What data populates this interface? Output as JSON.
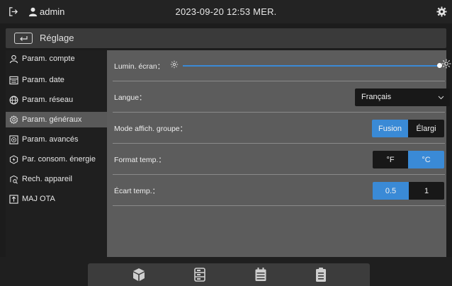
{
  "topbar": {
    "username": "admin",
    "datetime": "2023-09-20 12:53 MER.",
    "icons": [
      "logout-icon",
      "user-icon",
      "settings-gear-icon"
    ]
  },
  "header": {
    "title": "Réglage",
    "back_icon": "back-arrow-icon"
  },
  "sidebar": {
    "items": [
      {
        "label": "Param. compte",
        "icon": "user-icon",
        "active": false
      },
      {
        "label": "Param. date",
        "icon": "calendar-icon",
        "active": false
      },
      {
        "label": "Param. réseau",
        "icon": "globe-icon",
        "active": false
      },
      {
        "label": "Param. généraux",
        "icon": "gear-icon",
        "active": true
      },
      {
        "label": "Param. avancés",
        "icon": "advanced-settings-icon",
        "active": false
      },
      {
        "label": "Par. consom. énergie",
        "icon": "energy-icon",
        "active": false
      },
      {
        "label": "Rech. appareil",
        "icon": "device-search-icon",
        "active": false
      },
      {
        "label": "MAJ OTA",
        "icon": "ota-update-icon",
        "active": false
      }
    ]
  },
  "settings": {
    "brightness": {
      "label": "Lumin. écran：",
      "value": 1.0
    },
    "language": {
      "label": "Langue：",
      "value": "Français"
    },
    "group_display": {
      "label": "Mode affich. groupe：",
      "options": [
        "Fusion",
        "Élargi"
      ],
      "selected": "Fusion"
    },
    "temp_format": {
      "label": "Format temp.：",
      "options": [
        "°F",
        "°C"
      ],
      "selected": "°C"
    },
    "temp_gap": {
      "label": "Écart temp.：",
      "options": [
        "0.5",
        "1"
      ],
      "selected": "0.5"
    }
  },
  "dock": {
    "icons": [
      "cube-icon",
      "list-icon",
      "calendar-icon",
      "clipboard-icon"
    ]
  },
  "colors": {
    "accent": "#3a8ad6",
    "panel": "#5c5c5c",
    "sidebar_active": "#595959"
  }
}
